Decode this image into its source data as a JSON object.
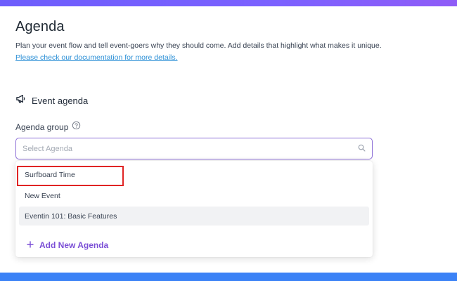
{
  "header": {
    "title": "Agenda",
    "description": "Plan your event flow and tell event-goers why they should come. Add details that highlight what makes it unique.",
    "doc_link": "Please check our documentation for more details."
  },
  "section": {
    "title": "Event agenda",
    "icon": "megaphone-icon"
  },
  "field": {
    "label": "Agenda group",
    "help_icon": "question-circle-icon",
    "placeholder": "Select Agenda",
    "search_icon": "search-icon"
  },
  "dropdown": {
    "options": [
      {
        "label": "Surfboard Time"
      },
      {
        "label": "New Event"
      },
      {
        "label": "Eventin 101: Basic Features"
      }
    ],
    "highlighted_option": "Eventin 101: Basic Features",
    "add_new_label": "Add New Agenda",
    "add_icon": "plus-icon"
  },
  "annotation": {
    "outlined_option": "Surfboard Time",
    "outline_color": "#e02424"
  },
  "colors": {
    "accent": "#7b4fd6",
    "link": "#2b8fd6",
    "top_strip": "#7b61ff",
    "bottom_strip": "#3b82f6"
  }
}
